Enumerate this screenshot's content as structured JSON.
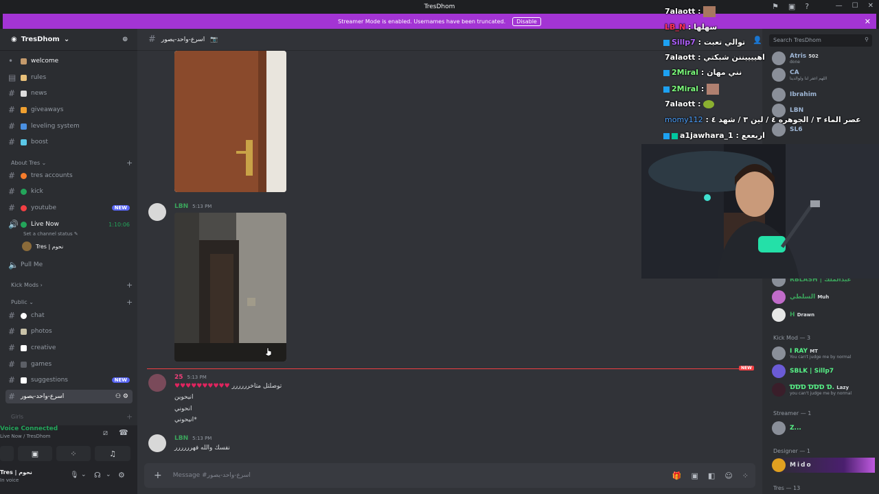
{
  "window": {
    "title": "TresDhom"
  },
  "banner": {
    "text": "Streamer Mode is enabled. Usernames have been truncated.",
    "button": "Disable"
  },
  "server": {
    "name": "TresDhom"
  },
  "channels": [
    {
      "name": "welcome"
    },
    {
      "name": "rules"
    },
    {
      "name": "news"
    },
    {
      "name": "giveaways"
    },
    {
      "name": "leveling system"
    },
    {
      "name": "boost"
    }
  ],
  "categories": {
    "about": "About Tres",
    "kick_mods": "Kick Mods",
    "public": "Public",
    "girls": "Girls"
  },
  "about_channels": [
    {
      "name": "tres accounts"
    },
    {
      "name": "kick"
    },
    {
      "name": "youtube",
      "badge": "NEW"
    },
    {
      "name": "Live Now",
      "time": "1:10:06",
      "status": "Set a channel status",
      "user": "Tres | نحوم"
    },
    {
      "name": "Pull Me"
    }
  ],
  "public_channels": [
    {
      "name": "chat"
    },
    {
      "name": "photos"
    },
    {
      "name": "creative"
    },
    {
      "name": "games"
    },
    {
      "name": "suggestions",
      "badge": "NEW"
    },
    {
      "name": "اسرع-واحد-يصور"
    }
  ],
  "voice": {
    "connected": "Voice Connected",
    "sub": "Live Now / TresDhom",
    "user": "Tres | نحوم",
    "status": "In voice"
  },
  "header": {
    "channel": "اسرع-واحد-يصور"
  },
  "messages": [
    {
      "user": "LBN",
      "time": "5:13 PM"
    },
    {
      "user": "25",
      "time": "5:13 PM",
      "lines": [
        "توصلتل متاخرررررر",
        "انيحوين",
        "انحوني",
        "انيحوني*"
      ]
    },
    {
      "user": "LBN",
      "time": "5:13 PM",
      "lines": [
        "نفسك والله فهرررررر"
      ]
    }
  ],
  "new_marker": "NEW",
  "input": {
    "placeholder": "Message #اسرع-واحد-يصور"
  },
  "search": {
    "placeholder": "Search TresDhom"
  },
  "members_top": [
    {
      "name": "Atris",
      "tag": "502",
      "status": "done",
      "color": "#9fb7d6"
    },
    {
      "name": "CA",
      "status": "اللهم اغفر لنا ولوالدينا",
      "color": "#9fb7d6"
    },
    {
      "name": "Ibrahim",
      "color": "#9fb7d6"
    },
    {
      "name": "LBN",
      "color": "#9fb7d6"
    },
    {
      "name": "SL6",
      "color": "#9fb7d6"
    }
  ],
  "members_lower": [
    {
      "name": "RBLASH | عبدالملك",
      "color": "#3ba55c"
    },
    {
      "name": "السلطي",
      "tag": "Muh",
      "color": "#3ba55c"
    },
    {
      "name": "H",
      "tag": "Drawn",
      "color": "#3ba55c"
    }
  ],
  "kick_mod_header": "Kick Mod — 3",
  "kick_mods": [
    {
      "name": "I RAY",
      "tag": "MT",
      "status": "You can't judge me by normal",
      "color": "#57f287"
    },
    {
      "name": "SBLK | Sillp7",
      "color": "#57f287"
    },
    {
      "name": "ƊƊƊ ƊƊƊ Ɗ.",
      "tag": "Lazy",
      "status": "you can't judge me by normal",
      "color": "#57f287"
    }
  ],
  "streamer_header": "Streamer — 1",
  "streamer": {
    "name": "Z...",
    "color": "#57f287"
  },
  "designer_header": "Designer — 1",
  "designer": {
    "name": "Mido",
    "color": "#dbdee1"
  },
  "tres_header": "Tres — 13",
  "stream_chat": [
    {
      "user": "7alaott",
      "msg": ""
    },
    {
      "user": "LB_N",
      "msg": "سهلها"
    },
    {
      "user": "Sillp7",
      "msg": "توالي تعبت"
    },
    {
      "user": "7alaott",
      "msg": "اهييييننن شبكتي"
    },
    {
      "user": "2Miral",
      "msg": "نني مهان"
    },
    {
      "user": "2Miral",
      "msg": ""
    },
    {
      "user": "7alaott",
      "msg": ""
    },
    {
      "user": "momy112",
      "msg": "عصر الماء ٣ / الجوهره ٤ / لين ٣ / شهد ٤"
    },
    {
      "user": "a1jawhara_1",
      "msg": "اربععع"
    }
  ],
  "colors": {
    "accent": "#5865f2",
    "banner": "#a334d4",
    "online": "#23a55a",
    "new": "#f23f43"
  }
}
